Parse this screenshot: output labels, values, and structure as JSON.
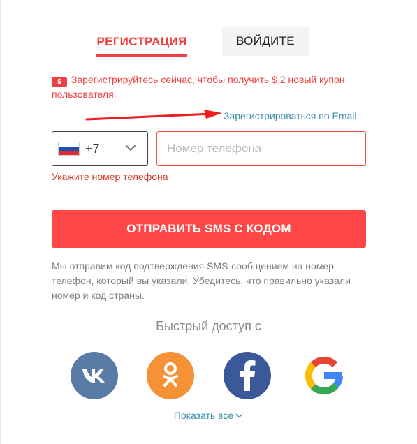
{
  "tabs": {
    "register": "РЕГИСТРАЦИЯ",
    "login": "ВОЙДИТЕ"
  },
  "promo": {
    "icon": "coupon-icon",
    "coupon_symbol": "$",
    "text": "Зарегистрируйтесь сейчас, чтобы получить $ 2 новый купон пользователя."
  },
  "email_link": "Зарегистрироваться по Email",
  "phone": {
    "country_flag": "russia-flag",
    "dial_code": "+7",
    "placeholder": "Номер телефона",
    "value": "",
    "error": "Укажите номер телефона"
  },
  "sms_button": "ОТПРАВИТЬ SMS С КОДОМ",
  "info_text": "Мы отправим код подтверждения SMS-сообщением на номер телефон, который вы указали. Убедитесь, что правильно указали номер и код страны.",
  "quick_access": {
    "title": "Быстрый доступ с",
    "providers": [
      {
        "name": "vk",
        "icon": "vk-icon",
        "color": "#587ca5"
      },
      {
        "name": "odnoklassniki",
        "icon": "ok-icon",
        "color": "#f59237"
      },
      {
        "name": "facebook",
        "icon": "facebook-icon",
        "color": "#3b5998"
      },
      {
        "name": "google",
        "icon": "google-icon",
        "color": "#ffffff"
      }
    ],
    "show_all": "Показать все"
  },
  "colors": {
    "accent": "#ff4747",
    "link": "#3f8fb0",
    "error": "#d6361f"
  }
}
